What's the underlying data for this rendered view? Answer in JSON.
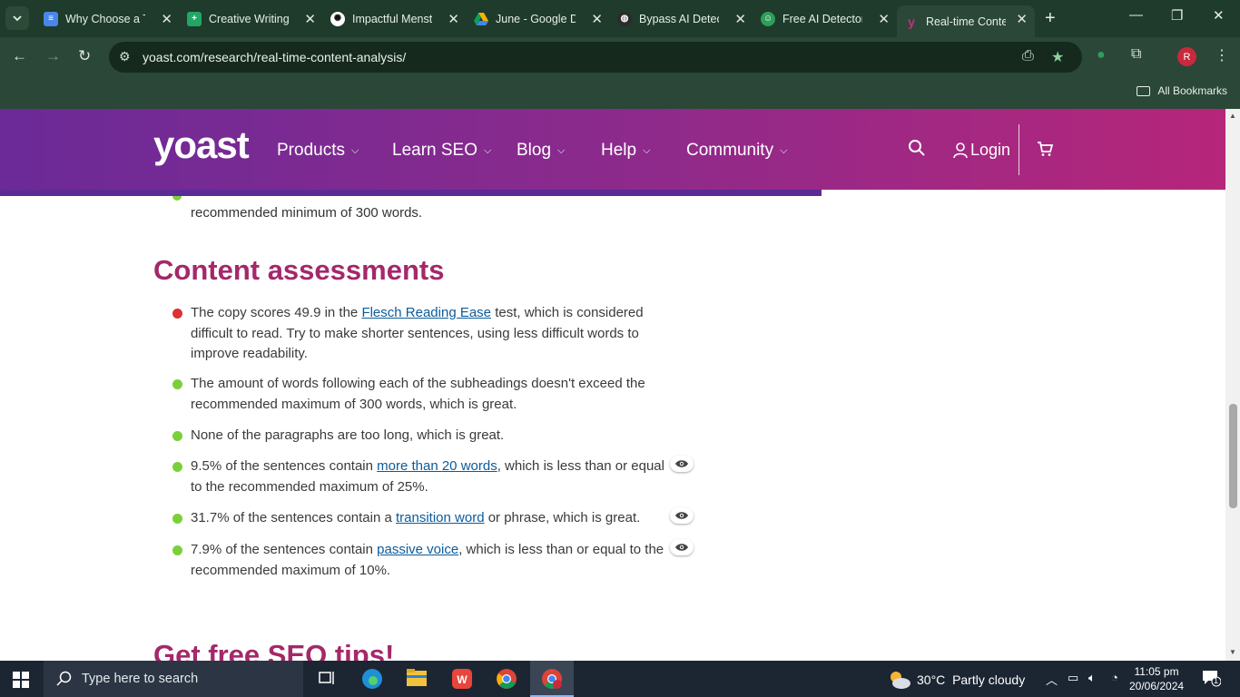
{
  "browser": {
    "tabs": [
      {
        "label": "Why Choose a T",
        "favicon": "google-docs",
        "color": "#4a86e8"
      },
      {
        "label": "Creative Writing",
        "favicon": "google-sheets",
        "color": "#23a566"
      },
      {
        "label": "Impactful Menst",
        "favicon": "chatgpt",
        "color": "#ffffff"
      },
      {
        "label": "June - Google D",
        "favicon": "google-drive",
        "color": "#f4b400"
      },
      {
        "label": "Bypass AI Detect",
        "favicon": "globe",
        "color": "#2b2b2b"
      },
      {
        "label": "Free AI Detector",
        "favicon": "robot",
        "color": "#2e9e5b"
      },
      {
        "label": "Real-time Conte",
        "favicon": "yoast",
        "color": "#a4286a",
        "active": true
      }
    ],
    "url": "yoast.com/research/real-time-content-analysis/",
    "bookmarks_label": "All Bookmarks",
    "profile_initial": "R"
  },
  "header": {
    "logo": "yoast",
    "nav": [
      {
        "label": "Products"
      },
      {
        "label": "Learn SEO"
      },
      {
        "label": "Blog"
      },
      {
        "label": "Help"
      },
      {
        "label": "Community"
      }
    ],
    "login": "Login"
  },
  "content": {
    "cut_off_text": "recommended minimum of 300 words.",
    "section_title": "Content assessments",
    "assessments": [
      {
        "status": "bad",
        "color": "#dc3232",
        "before": "The copy scores 49.9 in the ",
        "link": "Flesch Reading Ease",
        "after": " test, which is considered difficult to read. Try to make shorter sentences, using less difficult words to improve readability.",
        "eye": false
      },
      {
        "status": "good",
        "color": "#7ad03a",
        "before": "The amount of words following each of the subheadings doesn't exceed the recommended maximum of 300 words, which is great.",
        "link": "",
        "after": "",
        "eye": false
      },
      {
        "status": "good",
        "color": "#7ad03a",
        "before": "None of the paragraphs are too long, which is great.",
        "link": "",
        "after": "",
        "eye": false
      },
      {
        "status": "good",
        "color": "#7ad03a",
        "before": "9.5% of the sentences contain ",
        "link": "more than 20 words",
        "after": ", which is less than or equal to the recommended maximum of 25%.",
        "eye": true
      },
      {
        "status": "good",
        "color": "#7ad03a",
        "before": "31.7% of the sentences contain a ",
        "link": "transition word",
        "after": " or phrase, which is great.",
        "eye": true
      },
      {
        "status": "good",
        "color": "#7ad03a",
        "before": "7.9% of the sentences contain ",
        "link": "passive voice",
        "after": ", which is less than or equal to the recommended maximum of 10%.",
        "eye": true
      }
    ],
    "footer_title": "Get free SEO tips!"
  },
  "taskbar": {
    "search_placeholder": "Type here to search",
    "weather_temp": "30°C",
    "weather_desc": "Partly cloudy",
    "time": "11:05 pm",
    "date": "20/06/2024",
    "notification_count": "1"
  },
  "colors": {
    "accent": "#a4286a",
    "link": "#0b5b9b",
    "good": "#7ad03a",
    "bad": "#dc3232"
  }
}
